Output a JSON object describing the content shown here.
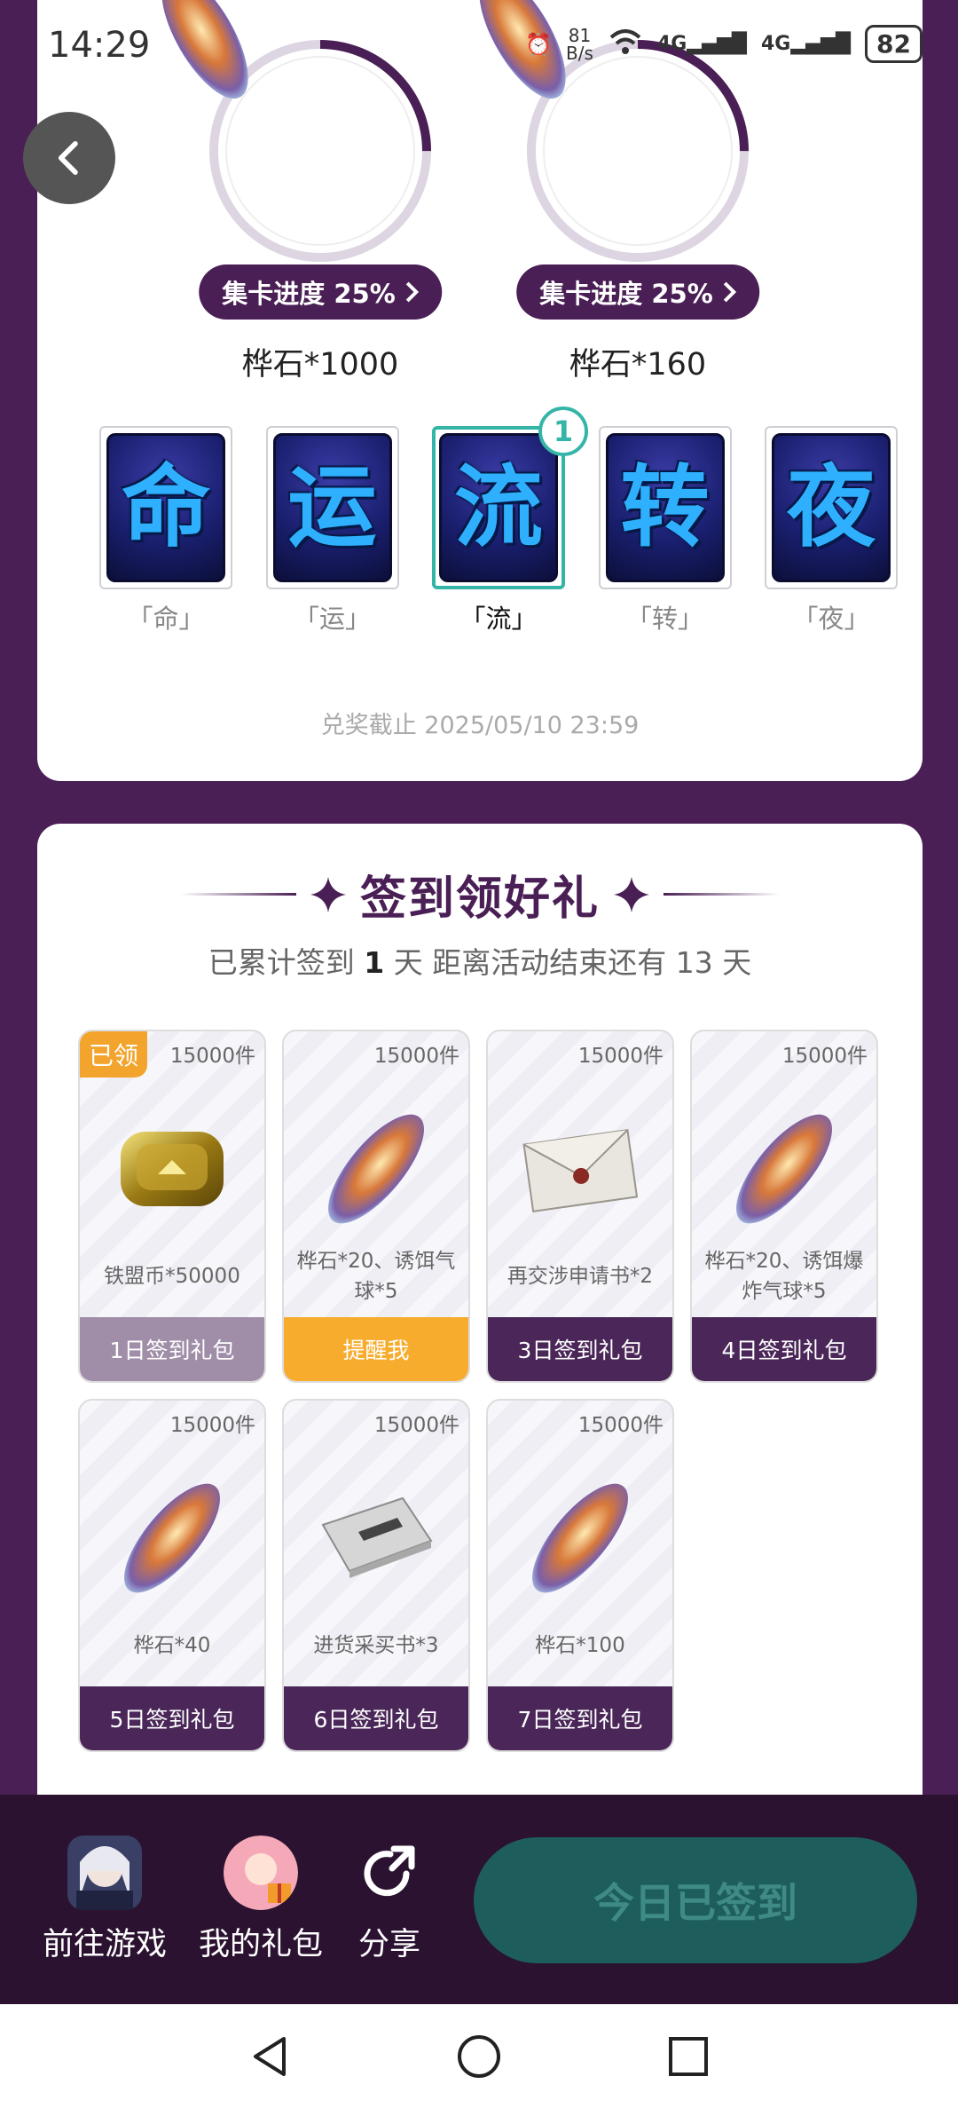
{
  "status_bar": {
    "time": "14:29",
    "net_speed_top": "81",
    "net_speed_unit": "B/s",
    "signal_1": "4G",
    "signal_2": "4G",
    "battery": "82"
  },
  "top_card": {
    "prizes": [
      {
        "progress_label": "集卡进度 25%",
        "name": "桦石*1000",
        "progress": 0.25
      },
      {
        "progress_label": "集卡进度 25%",
        "name": "桦石*160",
        "progress": 0.25
      }
    ],
    "cards": [
      {
        "glyph": "命",
        "label": "「命」",
        "active": false
      },
      {
        "glyph": "运",
        "label": "「运」",
        "active": false
      },
      {
        "glyph": "流",
        "label": "「流」",
        "active": true,
        "count": "1"
      },
      {
        "glyph": "转",
        "label": "「转」",
        "active": false
      },
      {
        "glyph": "夜",
        "label": "「夜」",
        "active": false
      }
    ],
    "deadline": "兑奖截止 2025/05/10 23:59"
  },
  "checkin": {
    "title": "签到领好礼",
    "sub_prefix": "已累计签到 ",
    "sub_days": "1",
    "sub_suffix": " 天  距离活动结束还有 13 天",
    "claimed_tag": "已领",
    "gifts": [
      {
        "stock": "15000件",
        "name": "铁盟币*50000",
        "button": "1日签到礼包",
        "state": "done",
        "icon": "gold-coin"
      },
      {
        "stock": "15000件",
        "name": "桦石*20、诱饵气球*5",
        "button": "提醒我",
        "state": "remind",
        "icon": "gem"
      },
      {
        "stock": "15000件",
        "name": "再交涉申请书*2",
        "button": "3日签到礼包",
        "state": "locked",
        "icon": "envelope"
      },
      {
        "stock": "15000件",
        "name": "桦石*20、诱饵爆炸气球*5",
        "button": "4日签到礼包",
        "state": "locked",
        "icon": "gem"
      },
      {
        "stock": "15000件",
        "name": "桦石*40",
        "button": "5日签到礼包",
        "state": "locked",
        "icon": "gem"
      },
      {
        "stock": "15000件",
        "name": "进货采买书*3",
        "button": "6日签到礼包",
        "state": "locked",
        "icon": "book"
      },
      {
        "stock": "15000件",
        "name": "桦石*100",
        "button": "7日签到礼包",
        "state": "locked",
        "icon": "gem"
      }
    ]
  },
  "action_bar": {
    "go_game": "前往游戏",
    "my_gifts": "我的礼包",
    "share": "分享",
    "cta": "今日已签到"
  },
  "colors": {
    "primary": "#4a1f55",
    "accent_teal": "#35b5a8",
    "remind_orange": "#f7ac2e"
  }
}
